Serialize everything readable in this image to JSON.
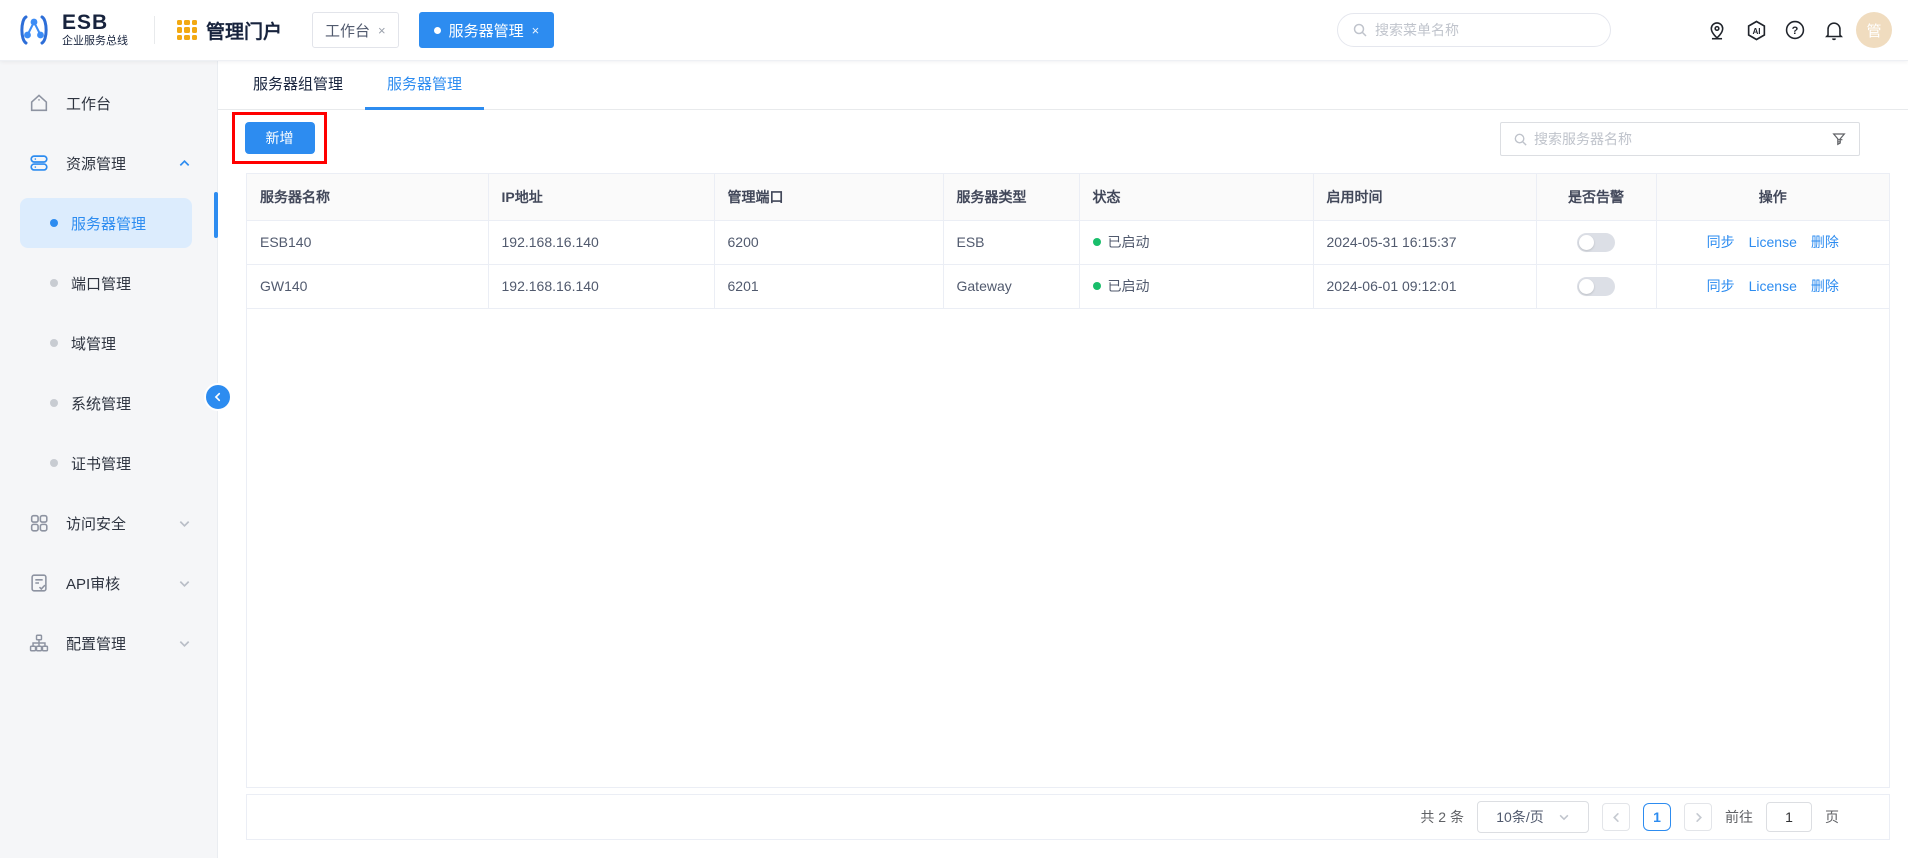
{
  "colors": {
    "primary": "#2d8cf0",
    "status_green": "#19be6b",
    "annotation_red": "#ff0000",
    "warn_yellow": "#f2a912"
  },
  "header": {
    "logo_title": "ESB",
    "logo_subtitle": "企业服务总线",
    "portal_title": "管理门户",
    "tabs": [
      {
        "label": "工作台",
        "close": "×",
        "active": false
      },
      {
        "label": "服务器管理",
        "close": "×",
        "active": true
      }
    ],
    "search_placeholder": "搜索菜单名称",
    "avatar_text": "管"
  },
  "sidebar": {
    "items": [
      {
        "label": "工作台",
        "icon": "home-icon"
      },
      {
        "label": "资源管理",
        "icon": "server-stack-icon",
        "expanded": true
      },
      {
        "label": "服务器管理",
        "active": true
      },
      {
        "label": "端口管理"
      },
      {
        "label": "域管理"
      },
      {
        "label": "系统管理"
      },
      {
        "label": "证书管理"
      },
      {
        "label": "访问安全",
        "icon": "grid-icon"
      },
      {
        "label": "API审核",
        "icon": "doc-check-icon"
      },
      {
        "label": "配置管理",
        "icon": "sitemap-icon"
      }
    ]
  },
  "main": {
    "tabs": [
      {
        "label": "服务器组管理",
        "active": false
      },
      {
        "label": "服务器管理",
        "active": true
      }
    ],
    "add_button": "新增",
    "search_placeholder": "搜索服务器名称",
    "table": {
      "columns": [
        "服务器名称",
        "IP地址",
        "管理端口",
        "服务器类型",
        "状态",
        "启用时间",
        "是否告警",
        "操作"
      ],
      "rows": [
        {
          "name": "ESB140",
          "ip": "192.168.16.140",
          "port": "6200",
          "type": "ESB",
          "status": "已启动",
          "time": "2024-05-31 16:15:37",
          "alarm_on": false,
          "actions": [
            "同步",
            "License",
            "删除"
          ]
        },
        {
          "name": "GW140",
          "ip": "192.168.16.140",
          "port": "6201",
          "type": "Gateway",
          "status": "已启动",
          "time": "2024-06-01 09:12:01",
          "alarm_on": false,
          "actions": [
            "同步",
            "License",
            "删除"
          ]
        }
      ]
    },
    "pagination": {
      "total": "共 2 条",
      "page_size": "10条/页",
      "current_page": "1",
      "goto_label": "前往",
      "goto_value": "1",
      "page_unit": "页"
    }
  }
}
